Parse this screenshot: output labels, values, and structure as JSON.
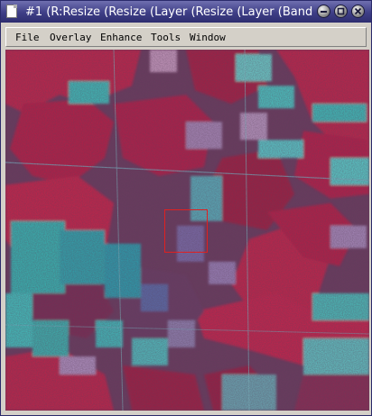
{
  "window": {
    "title": "#1 (R:Resize (Resize (Layer (Resize (Layer (Band"
  },
  "menu": {
    "items": [
      "File",
      "Overlay",
      "Enhance",
      "Tools",
      "Window"
    ]
  },
  "image": {
    "description_icon": "false-color-satellite-image"
  },
  "colors": {
    "titlebar": "#3e3e86",
    "vegetation": "#c8204a",
    "clearing": "#3ec8c0",
    "zoom_box": "#e02020"
  }
}
